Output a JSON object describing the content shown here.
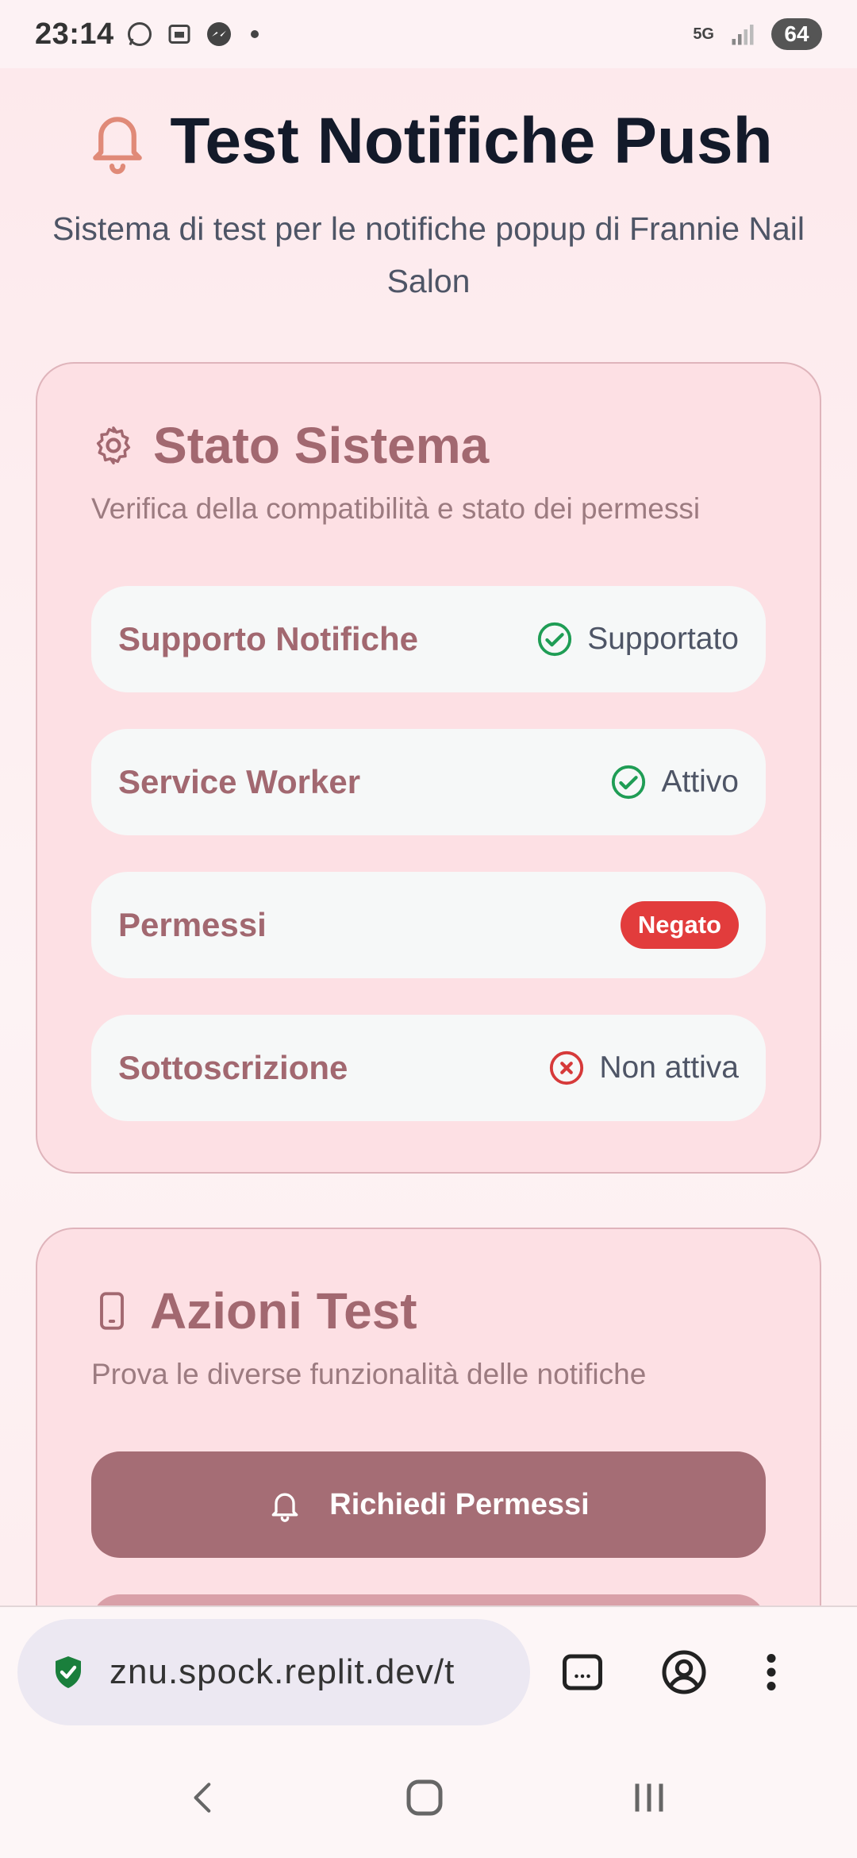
{
  "status_bar": {
    "time": "23:14",
    "network": "5G",
    "battery": "64"
  },
  "header": {
    "title": "Test Notifiche Push",
    "subtitle": "Sistema di test per le notifiche popup di Frannie Nail Salon"
  },
  "system_card": {
    "title": "Stato Sistema",
    "description": "Verifica della compatibilità e stato dei permessi",
    "rows": [
      {
        "label": "Supporto Notifiche",
        "status": "Supportato",
        "icon": "check-circle-icon"
      },
      {
        "label": "Service Worker",
        "status": "Attivo",
        "icon": "check-circle-icon"
      },
      {
        "label": "Permessi",
        "status": "Negato",
        "icon": "badge"
      },
      {
        "label": "Sottoscrizione",
        "status": "Non attiva",
        "icon": "x-circle-icon"
      }
    ]
  },
  "actions_card": {
    "title": "Azioni Test",
    "description": "Prova le diverse funzionalità delle notifiche",
    "buttons": [
      {
        "label": "Richiedi Permessi",
        "icon": "bell-icon"
      }
    ]
  },
  "browser": {
    "url": "znu.spock.replit.dev/t"
  },
  "colors": {
    "accent": "#a56d75",
    "success": "#1f9d55",
    "danger": "#e23c3c",
    "title": "#131a2a"
  }
}
